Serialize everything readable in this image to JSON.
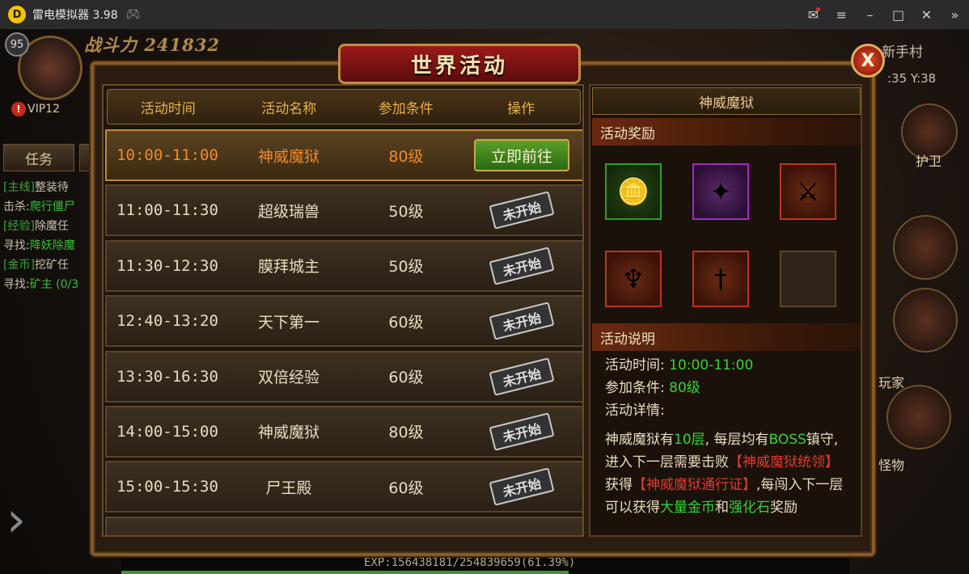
{
  "window": {
    "title": "雷电模拟器 3.98",
    "logo_letter": "D"
  },
  "player": {
    "level": "95",
    "power_label": "战斗力",
    "power_value": "241832",
    "vip": "VIP12",
    "map": "新手村",
    "coords": ":35 Y:38"
  },
  "side": {
    "tab_task": "任务",
    "quests": [
      {
        "tag": "[主线]",
        "text": "整装待"
      },
      {
        "tag": "击杀:",
        "text": "爬行僵尸"
      },
      {
        "tag": "[经验]",
        "text": "除魔任"
      },
      {
        "tag": "寻找:",
        "text": "降妖除魔"
      },
      {
        "tag": "[金币]",
        "text": "挖矿任"
      },
      {
        "tag": "寻找:",
        "text": "矿主 (0/3"
      }
    ],
    "label_guard": "护卫",
    "label_player": "玩家",
    "label_monster": "怪物"
  },
  "exp": {
    "text": "EXP:156438181/254839659(61.39%)",
    "fraction": 0.6139
  },
  "dialog": {
    "title": "世界活动",
    "close": "X",
    "headers": {
      "time": "活动时间",
      "name": "活动名称",
      "cond": "参加条件",
      "op": "操作"
    },
    "rows": [
      {
        "time": "10:00-11:00",
        "name": "神威魔狱",
        "cond": "80级",
        "action": "立即前往"
      },
      {
        "time": "11:00-11:30",
        "name": "超级瑞兽",
        "cond": "50级",
        "action": "未开始"
      },
      {
        "time": "11:30-12:30",
        "name": "膜拜城主",
        "cond": "50级",
        "action": "未开始"
      },
      {
        "time": "12:40-13:20",
        "name": "天下第一",
        "cond": "60级",
        "action": "未开始"
      },
      {
        "time": "13:30-16:30",
        "name": "双倍经验",
        "cond": "60级",
        "action": "未开始"
      },
      {
        "time": "14:00-15:00",
        "name": "神威魔狱",
        "cond": "80级",
        "action": "未开始"
      },
      {
        "time": "15:00-15:30",
        "name": "尸王殿",
        "cond": "60级",
        "action": "未开始"
      }
    ],
    "detail": {
      "title": "神威魔狱",
      "reward_section": "活动奖励",
      "desc_section": "活动说明",
      "time_label": "活动时间:",
      "time_value": "10:00-11:00",
      "cond_label": "参加条件:",
      "cond_value": "80级",
      "detail_label": "活动详情:",
      "p1": "神威魔狱有",
      "p2": "10层",
      "p3": ", 每层均有",
      "p4": "BOSS",
      "p5": "镇守, 进入下一层需要击败",
      "p6": "【神威魔狱统领】",
      "p7": "获得",
      "p8": "【神威魔狱通行证】",
      "p9": ",每闯入下一层可以获得",
      "p10": "大量金币",
      "p11": "和",
      "p12": "强化石",
      "p13": "奖励"
    }
  }
}
